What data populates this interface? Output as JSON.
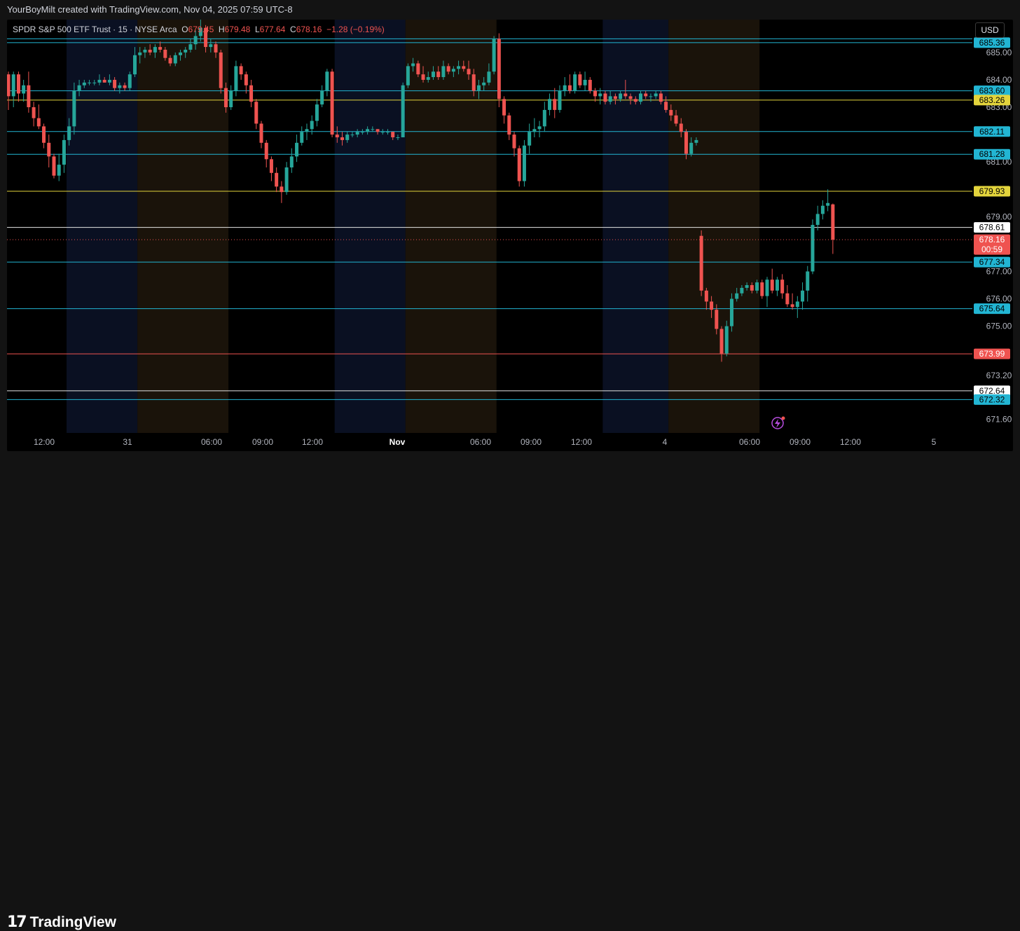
{
  "credit": "YourBoyMilt created with TradingView.com, Nov 04, 2025 07:59 UTC-8",
  "brand": {
    "logo_mark": "17",
    "name": "TradingView"
  },
  "currency_button": "USD",
  "legend": {
    "symbol": "SPDR S&P 500 ETF Trust · 15 · NYSE Arca",
    "o_label": "O",
    "o_value": "679.45",
    "h_label": "H",
    "h_value": "679.48",
    "l_label": "L",
    "l_value": "677.64",
    "c_label": "C",
    "c_value": "678.16",
    "change": "−1.28 (−0.19%)"
  },
  "countdown": "00:59",
  "colors": {
    "up": "#26a69a",
    "down": "#ef5350",
    "cyan_line": "#22b5d3",
    "yellow_line": "#e3d43c",
    "white_line": "#e6e6e6",
    "red_line": "#ef5350",
    "premarket_shade": "#0a1022",
    "afterhours_shade": "#1a130a",
    "background": "#000000"
  },
  "chart_data": {
    "type": "candlestick",
    "timeframe": "15",
    "ylim": [
      671.1,
      686.2
    ],
    "price_axis_labels": [
      "685.00",
      "684.00",
      "683.00",
      "681.00",
      "679.00",
      "677.00",
      "676.00",
      "675.00",
      "673.20",
      "671.60"
    ],
    "time_axis_labels": [
      "12:00",
      "31",
      "06:00",
      "09:00",
      "12:00",
      "Nov",
      "06:00",
      "09:00",
      "12:00",
      "4",
      "06:00",
      "09:00",
      "12:00",
      "5"
    ],
    "horizontal_levels": [
      {
        "value": 685.5,
        "color": "cyan",
        "label": ""
      },
      {
        "value": 685.36,
        "color": "cyan",
        "label": "685.36"
      },
      {
        "value": 683.6,
        "color": "cyan",
        "label": "683.60"
      },
      {
        "value": 683.26,
        "color": "yellow",
        "label": "683.26"
      },
      {
        "value": 682.11,
        "color": "cyan",
        "label": "682.11"
      },
      {
        "value": 681.28,
        "color": "cyan",
        "label": "681.28"
      },
      {
        "value": 679.93,
        "color": "yellow",
        "label": "679.93"
      },
      {
        "value": 678.61,
        "color": "white",
        "label": "678.61"
      },
      {
        "value": 677.34,
        "color": "cyan",
        "label": "677.34"
      },
      {
        "value": 675.64,
        "color": "cyan",
        "label": "675.64"
      },
      {
        "value": 673.99,
        "color": "red",
        "label": "673.99"
      },
      {
        "value": 672.64,
        "color": "white",
        "label": "672.64"
      },
      {
        "value": 672.32,
        "color": "cyan",
        "label": "672.32"
      }
    ],
    "last_price": {
      "value": 678.16,
      "label": "678.16"
    },
    "session_shading": [
      {
        "type": "premarket",
        "from_bar": 12,
        "to_bar": 26
      },
      {
        "type": "afterhours",
        "from_bar": 26,
        "to_bar": 44
      },
      {
        "type": "premarket",
        "from_bar": 65,
        "to_bar": 79
      },
      {
        "type": "afterhours",
        "from_bar": 79,
        "to_bar": 97
      },
      {
        "type": "premarket",
        "from_bar": 118,
        "to_bar": 131
      },
      {
        "type": "afterhours",
        "from_bar": 131,
        "to_bar": 149
      }
    ],
    "candles": [
      [
        684.2,
        684.3,
        682.9,
        683.4
      ],
      [
        683.4,
        684.3,
        683.0,
        684.2
      ],
      [
        684.2,
        684.3,
        683.2,
        683.5
      ],
      [
        683.5,
        684.0,
        683.2,
        683.8
      ],
      [
        683.8,
        684.3,
        682.8,
        683.0
      ],
      [
        683.0,
        683.2,
        682.3,
        682.6
      ],
      [
        682.6,
        683.1,
        682.2,
        682.3
      ],
      [
        682.3,
        682.4,
        681.5,
        681.7
      ],
      [
        681.7,
        682.0,
        680.8,
        681.2
      ],
      [
        681.2,
        681.3,
        680.4,
        680.5
      ],
      [
        680.5,
        681.3,
        680.3,
        680.9
      ],
      [
        680.9,
        682.0,
        680.6,
        681.8
      ],
      [
        681.8,
        682.6,
        681.6,
        682.3
      ],
      [
        682.3,
        683.9,
        682.0,
        683.6
      ],
      [
        683.6,
        684.0,
        683.4,
        683.8
      ],
      [
        683.8,
        684.0,
        683.7,
        683.9
      ],
      [
        683.9,
        684.0,
        683.8,
        683.9
      ],
      [
        683.9,
        684.0,
        683.8,
        683.9
      ],
      [
        683.9,
        684.2,
        683.8,
        684.0
      ],
      [
        684.0,
        684.1,
        683.9,
        683.9
      ],
      [
        683.9,
        684.2,
        683.8,
        684.0
      ],
      [
        684.0,
        684.1,
        683.6,
        683.7
      ],
      [
        683.7,
        683.9,
        683.5,
        683.8
      ],
      [
        683.8,
        683.9,
        683.6,
        683.7
      ],
      [
        683.7,
        684.3,
        683.6,
        684.2
      ],
      [
        684.2,
        685.2,
        684.1,
        684.9
      ],
      [
        684.9,
        685.2,
        684.6,
        685.0
      ],
      [
        685.0,
        685.2,
        684.8,
        685.1
      ],
      [
        685.1,
        685.3,
        684.9,
        685.0
      ],
      [
        685.0,
        685.3,
        684.8,
        685.2
      ],
      [
        685.2,
        685.4,
        685.0,
        685.1
      ],
      [
        685.1,
        685.2,
        684.7,
        684.8
      ],
      [
        684.8,
        684.9,
        684.5,
        684.6
      ],
      [
        684.6,
        685.0,
        684.5,
        684.9
      ],
      [
        684.9,
        685.1,
        684.7,
        685.0
      ],
      [
        685.0,
        685.2,
        684.8,
        685.1
      ],
      [
        685.1,
        685.5,
        685.0,
        685.3
      ],
      [
        685.3,
        685.8,
        685.1,
        685.6
      ],
      [
        685.6,
        686.2,
        685.4,
        685.9
      ],
      [
        685.9,
        686.0,
        685.0,
        685.2
      ],
      [
        685.2,
        685.5,
        685.0,
        685.3
      ],
      [
        685.3,
        685.4,
        684.8,
        685.0
      ],
      [
        685.0,
        685.1,
        683.5,
        683.7
      ],
      [
        683.7,
        683.9,
        682.8,
        683.0
      ],
      [
        683.0,
        683.8,
        682.9,
        683.6
      ],
      [
        683.6,
        684.7,
        683.4,
        684.5
      ],
      [
        684.5,
        684.6,
        684.0,
        684.2
      ],
      [
        684.2,
        684.3,
        683.5,
        683.8
      ],
      [
        683.8,
        684.0,
        683.0,
        683.2
      ],
      [
        683.2,
        683.3,
        682.2,
        682.4
      ],
      [
        682.4,
        682.5,
        681.5,
        681.7
      ],
      [
        681.7,
        681.8,
        680.8,
        681.1
      ],
      [
        681.1,
        681.2,
        680.3,
        680.6
      ],
      [
        680.6,
        680.8,
        679.9,
        680.1
      ],
      [
        680.1,
        680.3,
        679.5,
        679.9
      ],
      [
        679.9,
        681.0,
        679.8,
        680.8
      ],
      [
        680.8,
        681.5,
        680.6,
        681.2
      ],
      [
        681.2,
        682.0,
        681.0,
        681.7
      ],
      [
        681.7,
        682.3,
        681.6,
        682.1
      ],
      [
        682.1,
        682.4,
        681.8,
        682.2
      ],
      [
        682.2,
        682.7,
        682.0,
        682.5
      ],
      [
        682.5,
        683.3,
        682.3,
        683.1
      ],
      [
        683.1,
        683.8,
        683.0,
        683.6
      ],
      [
        683.6,
        684.4,
        683.4,
        684.3
      ],
      [
        684.3,
        684.4,
        681.9,
        682.0
      ],
      [
        682.0,
        682.3,
        681.7,
        681.9
      ],
      [
        681.9,
        682.1,
        681.6,
        681.8
      ],
      [
        681.8,
        682.1,
        681.7,
        682.0
      ],
      [
        682.0,
        682.1,
        681.9,
        682.0
      ],
      [
        682.0,
        682.2,
        681.9,
        682.1
      ],
      [
        682.1,
        682.2,
        682.0,
        682.1
      ],
      [
        682.1,
        682.3,
        682.0,
        682.2
      ],
      [
        682.2,
        682.3,
        682.1,
        682.2
      ],
      [
        682.2,
        682.2,
        682.0,
        682.1
      ],
      [
        682.1,
        682.2,
        682.0,
        682.1
      ],
      [
        682.1,
        682.2,
        682.0,
        682.1
      ],
      [
        682.1,
        682.1,
        681.8,
        681.9
      ],
      [
        681.9,
        682.0,
        681.8,
        681.9
      ],
      [
        681.9,
        683.9,
        681.9,
        683.8
      ],
      [
        683.8,
        684.6,
        683.7,
        684.5
      ],
      [
        684.5,
        684.8,
        684.3,
        684.6
      ],
      [
        684.6,
        684.7,
        684.1,
        684.2
      ],
      [
        684.2,
        684.5,
        683.9,
        684.0
      ],
      [
        684.0,
        684.3,
        683.9,
        684.1
      ],
      [
        684.1,
        684.5,
        684.0,
        684.3
      ],
      [
        684.3,
        684.5,
        684.0,
        684.1
      ],
      [
        684.1,
        684.7,
        684.0,
        684.5
      ],
      [
        684.5,
        684.6,
        684.2,
        684.3
      ],
      [
        684.3,
        684.5,
        684.1,
        684.4
      ],
      [
        684.4,
        684.7,
        684.2,
        684.5
      ],
      [
        684.5,
        684.7,
        684.3,
        684.4
      ],
      [
        684.4,
        684.7,
        684.0,
        684.2
      ],
      [
        684.2,
        684.4,
        683.4,
        683.6
      ],
      [
        683.6,
        684.0,
        683.3,
        683.8
      ],
      [
        683.8,
        684.1,
        683.6,
        683.9
      ],
      [
        683.9,
        684.6,
        683.8,
        684.3
      ],
      [
        684.3,
        685.6,
        684.2,
        685.5
      ],
      [
        685.5,
        685.7,
        683.0,
        683.3
      ],
      [
        683.3,
        683.4,
        682.4,
        682.7
      ],
      [
        682.7,
        682.8,
        681.8,
        682.0
      ],
      [
        682.0,
        682.1,
        681.2,
        681.5
      ],
      [
        681.5,
        681.6,
        680.1,
        680.3
      ],
      [
        680.3,
        681.8,
        680.1,
        681.6
      ],
      [
        681.6,
        682.4,
        681.3,
        682.1
      ],
      [
        682.1,
        682.6,
        681.9,
        682.2
      ],
      [
        682.2,
        682.5,
        681.9,
        682.3
      ],
      [
        682.3,
        683.2,
        682.1,
        682.9
      ],
      [
        682.9,
        683.5,
        682.7,
        683.3
      ],
      [
        683.3,
        683.7,
        682.6,
        682.9
      ],
      [
        682.9,
        683.8,
        682.8,
        683.6
      ],
      [
        683.6,
        684.1,
        683.4,
        683.8
      ],
      [
        683.8,
        684.2,
        683.5,
        683.6
      ],
      [
        683.6,
        684.3,
        683.5,
        684.2
      ],
      [
        684.2,
        684.3,
        683.7,
        683.8
      ],
      [
        683.8,
        684.3,
        683.6,
        684.0
      ],
      [
        684.0,
        684.1,
        683.5,
        683.6
      ],
      [
        683.6,
        683.7,
        683.2,
        683.4
      ],
      [
        683.4,
        683.7,
        683.1,
        683.5
      ],
      [
        683.5,
        683.6,
        683.1,
        683.2
      ],
      [
        683.2,
        683.6,
        683.1,
        683.4
      ],
      [
        683.4,
        683.5,
        683.1,
        683.3
      ],
      [
        683.3,
        683.6,
        683.2,
        683.5
      ],
      [
        683.5,
        684.0,
        683.3,
        683.4
      ],
      [
        683.4,
        683.5,
        683.1,
        683.3
      ],
      [
        683.3,
        683.4,
        683.1,
        683.2
      ],
      [
        683.2,
        683.6,
        683.1,
        683.5
      ],
      [
        683.5,
        683.6,
        683.3,
        683.4
      ],
      [
        683.4,
        683.5,
        683.2,
        683.4
      ],
      [
        683.4,
        683.6,
        683.3,
        683.5
      ],
      [
        683.5,
        683.6,
        683.1,
        683.2
      ],
      [
        683.2,
        683.4,
        682.8,
        682.9
      ],
      [
        682.9,
        683.1,
        682.5,
        682.7
      ],
      [
        682.7,
        682.9,
        682.3,
        682.4
      ],
      [
        682.4,
        682.6,
        681.9,
        682.1
      ],
      [
        682.1,
        682.2,
        681.1,
        681.3
      ],
      [
        681.3,
        681.9,
        681.2,
        681.7
      ],
      [
        681.7,
        681.9,
        681.6,
        681.8
      ],
      [
        678.3,
        678.5,
        676.1,
        676.3
      ],
      [
        676.3,
        676.4,
        675.6,
        675.9
      ],
      [
        675.9,
        676.1,
        675.3,
        675.6
      ],
      [
        675.6,
        675.8,
        674.7,
        674.9
      ],
      [
        674.9,
        675.0,
        673.7,
        674.0
      ],
      [
        674.0,
        675.2,
        673.9,
        675.0
      ],
      [
        675.0,
        676.2,
        674.8,
        676.0
      ],
      [
        676.0,
        676.4,
        675.9,
        676.2
      ],
      [
        676.2,
        676.5,
        676.1,
        676.4
      ],
      [
        676.4,
        676.6,
        676.3,
        676.5
      ],
      [
        676.5,
        676.6,
        676.2,
        676.3
      ],
      [
        676.3,
        676.7,
        676.2,
        676.6
      ],
      [
        676.6,
        676.7,
        676.0,
        676.1
      ],
      [
        676.1,
        676.8,
        675.7,
        676.7
      ],
      [
        676.7,
        677.1,
        676.2,
        676.3
      ],
      [
        676.3,
        676.8,
        676.1,
        676.7
      ],
      [
        676.7,
        676.9,
        676.0,
        676.2
      ],
      [
        676.2,
        676.5,
        675.7,
        675.8
      ],
      [
        675.8,
        676.2,
        675.6,
        675.7
      ],
      [
        675.7,
        676.1,
        675.3,
        675.9
      ],
      [
        675.9,
        676.6,
        675.6,
        676.3
      ],
      [
        676.3,
        677.2,
        675.9,
        677.0
      ],
      [
        677.0,
        678.9,
        676.9,
        678.7
      ],
      [
        678.7,
        679.4,
        678.5,
        679.1
      ],
      [
        679.1,
        679.6,
        678.9,
        679.4
      ],
      [
        679.4,
        680.0,
        679.2,
        679.5
      ],
      [
        679.45,
        679.48,
        677.64,
        678.16
      ]
    ]
  }
}
